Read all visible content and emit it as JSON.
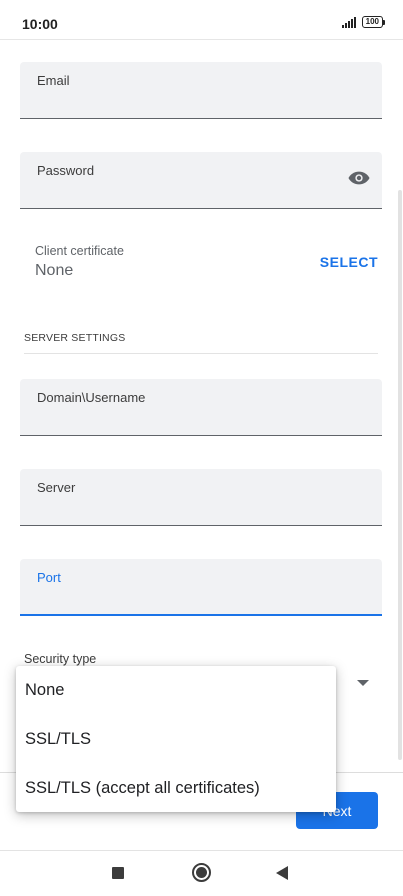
{
  "status_bar": {
    "time": "10:00",
    "battery": "100"
  },
  "form": {
    "email": {
      "label": "Email",
      "value": ""
    },
    "password": {
      "label": "Password",
      "value": ""
    },
    "client_certificate": {
      "label": "Client certificate",
      "value": "None",
      "action": "SELECT"
    },
    "section_title": "SERVER SETTINGS",
    "username": {
      "label": "Domain\\Username",
      "value": ""
    },
    "server": {
      "label": "Server",
      "value": ""
    },
    "port": {
      "label": "Port",
      "value": ""
    },
    "security_type": {
      "label": "Security type"
    }
  },
  "dropdown": {
    "options": [
      "None",
      "SSL/TLS",
      "SSL/TLS (accept all certificates)"
    ]
  },
  "next_button": {
    "label": "Next"
  },
  "icons": {
    "password_toggle": "eye-icon",
    "nav_recents": "square-icon",
    "nav_home": "circle-icon",
    "nav_back": "triangle-back-icon"
  },
  "colors": {
    "accent": "#1a73e8",
    "field_background": "#f1f2f4"
  }
}
